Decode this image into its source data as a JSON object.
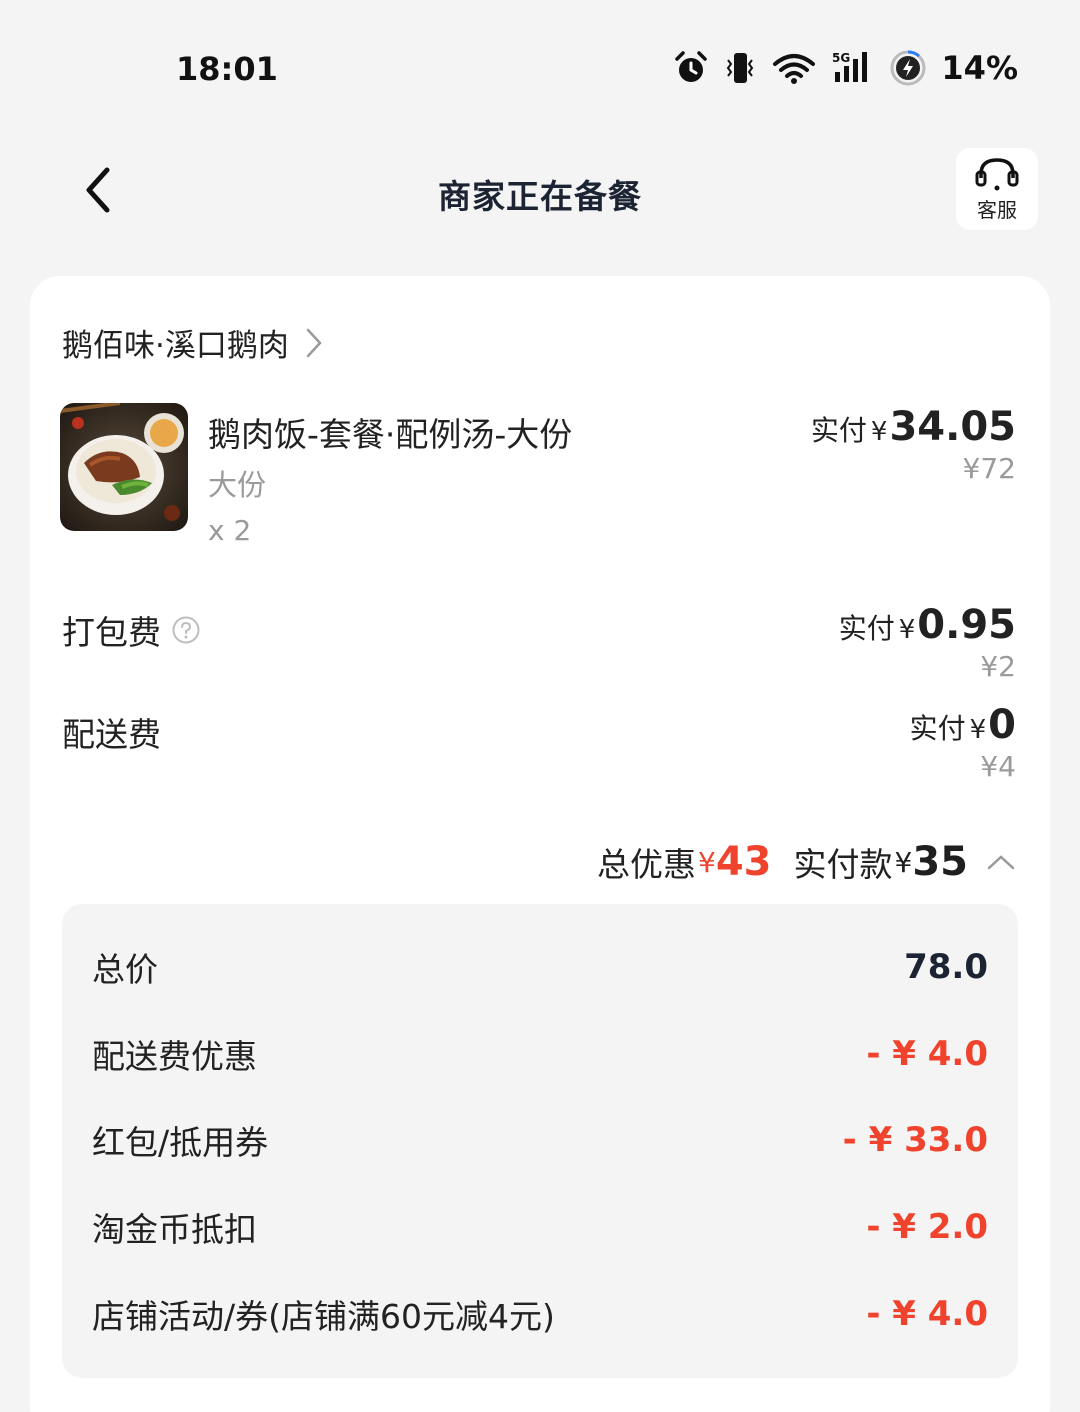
{
  "status_bar": {
    "time": "18:01",
    "battery": "14%",
    "icons": [
      "alarm-icon",
      "vibrate-icon",
      "wifi-icon",
      "signal-5g-icon",
      "battery-saver-icon"
    ]
  },
  "header": {
    "title": "商家正在备餐",
    "service_label": "客服"
  },
  "shop": {
    "name": "鹅佰味·溪口鹅肉"
  },
  "item": {
    "name": "鹅肉饭-套餐·配例汤-大份",
    "spec": "大份",
    "qty": "x 2",
    "paid_label": "实付",
    "paid_yen": "¥",
    "paid_amount": "34.05",
    "original": "¥72"
  },
  "packing_fee": {
    "label": "打包费",
    "paid_label": "实付",
    "paid_yen": "¥",
    "paid_amount": "0.95",
    "original": "¥2"
  },
  "delivery_fee": {
    "label": "配送费",
    "paid_label": "实付",
    "paid_yen": "¥",
    "paid_amount": "0",
    "original": "¥4"
  },
  "summary": {
    "discount_label": "总优惠",
    "discount_yen": "¥",
    "discount_amount": "43",
    "paid_label": "实付款",
    "paid_yen": "¥",
    "paid_amount": "35"
  },
  "breakdown": [
    {
      "label": "总价",
      "value": "78.0"
    },
    {
      "label": "配送费优惠",
      "value": "- ¥ 4.0"
    },
    {
      "label": "红包/抵用券",
      "value": "- ¥ 33.0"
    },
    {
      "label": "淘金币抵扣",
      "value": "- ¥ 2.0"
    },
    {
      "label": "店铺活动/券(店铺满60元减4元)",
      "value": "- ¥ 4.0"
    }
  ],
  "colors": {
    "accent_red": "#f0432d",
    "title": "#1c2433",
    "muted": "#9a9a9a"
  }
}
